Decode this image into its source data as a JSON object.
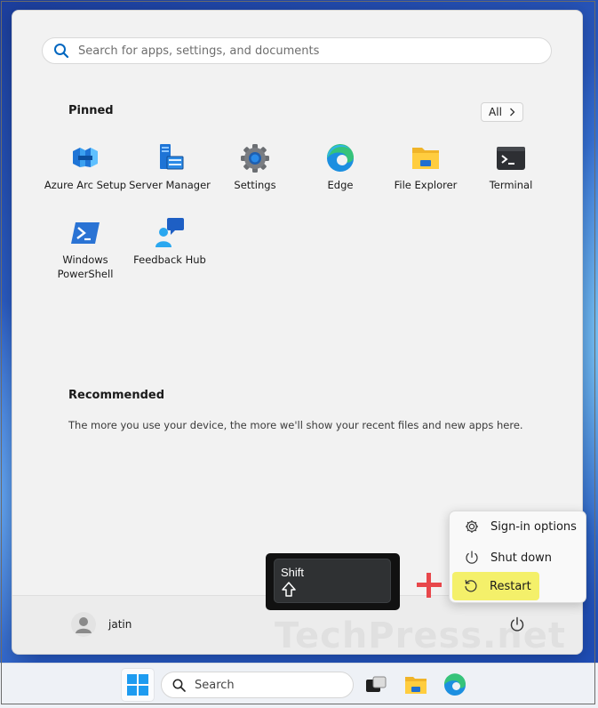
{
  "search": {
    "placeholder": "Search for apps, settings, and documents"
  },
  "pinned": {
    "title": "Pinned",
    "all_label": "All",
    "apps": [
      {
        "label": "Azure Arc Setup",
        "icon": "azure-arc-icon"
      },
      {
        "label": "Server Manager",
        "icon": "server-manager-icon"
      },
      {
        "label": "Settings",
        "icon": "gear-icon"
      },
      {
        "label": "Edge",
        "icon": "edge-icon"
      },
      {
        "label": "File Explorer",
        "icon": "folder-icon"
      },
      {
        "label": "Terminal",
        "icon": "terminal-icon"
      },
      {
        "label_line1": "Windows",
        "label_line2": "PowerShell",
        "icon": "powershell-icon"
      },
      {
        "label": "Feedback Hub",
        "icon": "feedback-hub-icon"
      }
    ]
  },
  "recommended": {
    "title": "Recommended",
    "text": "The more you use your device, the more we'll show your recent files and new apps here."
  },
  "user": {
    "name": "jatin"
  },
  "power_menu": {
    "items": [
      {
        "label": "Sign-in options",
        "icon": "gear-icon"
      },
      {
        "label": "Shut down",
        "icon": "power-icon"
      },
      {
        "label": "Restart",
        "icon": "restart-icon"
      }
    ]
  },
  "shift_key": {
    "label": "Shift"
  },
  "watermark": "TechPress.net",
  "taskbar": {
    "search_label": "Search"
  },
  "colors": {
    "highlight": "#f4f06a",
    "plus": "#e8474b",
    "accent": "#0067c0"
  }
}
